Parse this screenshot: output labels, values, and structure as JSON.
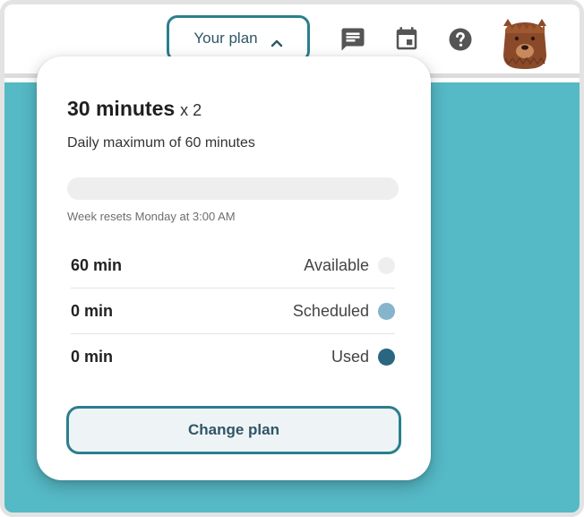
{
  "header": {
    "plan_toggle_label": "Your plan",
    "icons": [
      "message-icon",
      "calendar-icon",
      "help-icon"
    ],
    "avatar": "bear-avatar"
  },
  "plan": {
    "minutes_title": "30 minutes",
    "multiplier": "x 2",
    "daily_max": "Daily maximum of 60 minutes",
    "week_progress_fraction": 0,
    "reset_note": "Week resets Monday at 3:00 AM",
    "rows": [
      {
        "amount": "60 min",
        "label": "Available",
        "color": "#eeeeee"
      },
      {
        "amount": "0 min",
        "label": "Scheduled",
        "color": "#86b4cc"
      },
      {
        "amount": "0 min",
        "label": "Used",
        "color": "#2b6680"
      }
    ],
    "change_button": "Change plan"
  },
  "colors": {
    "accent": "#2a7f8c",
    "background_teal": "#55b9c6"
  }
}
